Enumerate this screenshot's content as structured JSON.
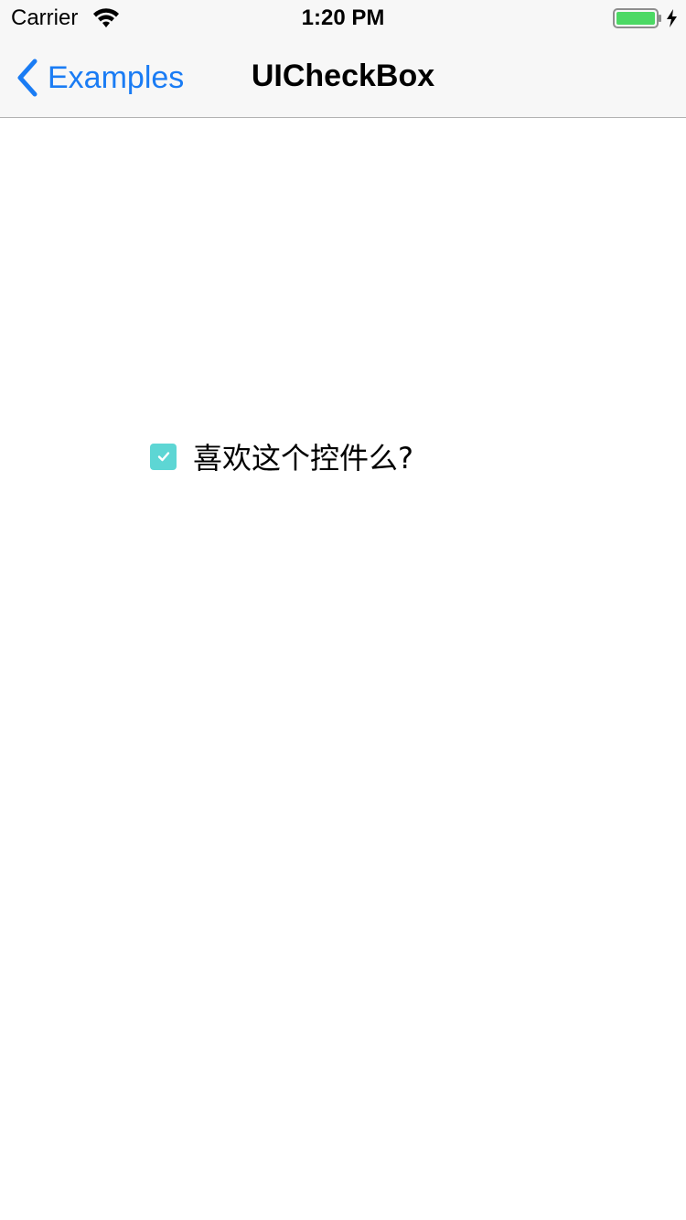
{
  "status_bar": {
    "carrier": "Carrier",
    "time": "1:20 PM",
    "wifi_icon": "wifi-icon",
    "battery_icon": "battery-charging-icon",
    "battery_color": "#4cd964"
  },
  "nav_bar": {
    "back_label": "Examples",
    "back_icon": "chevron-left-icon",
    "title": "UICheckBox",
    "tint_color": "#1a7cf4"
  },
  "content": {
    "checkbox": {
      "checked": true,
      "label": "喜欢这个控件么?",
      "fill_color": "#5dd6d4",
      "icon": "checkmark-icon"
    }
  }
}
